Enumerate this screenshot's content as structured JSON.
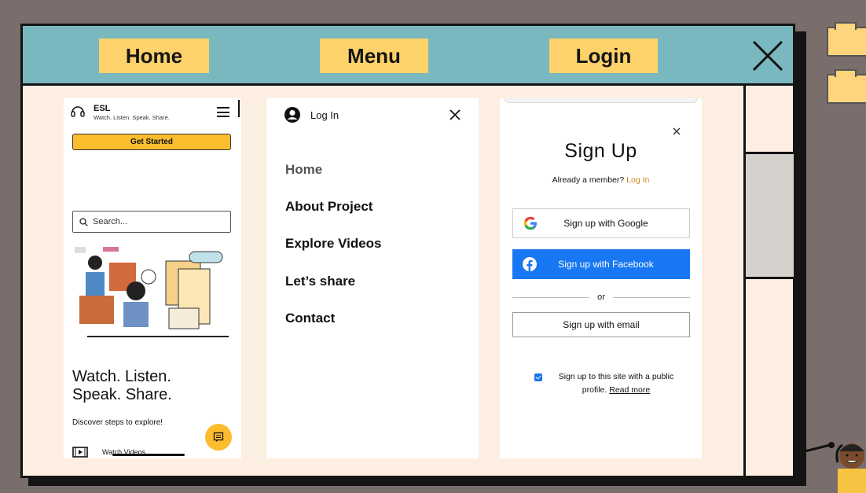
{
  "nav": {
    "tabs": [
      {
        "label": "Home"
      },
      {
        "label": "Menu"
      },
      {
        "label": "Login"
      }
    ],
    "close_icon": "close-icon"
  },
  "home_screen": {
    "brand": "ESL",
    "tagline": "Watch. Listen. Speak. Share.",
    "get_started": "Get Started",
    "search_placeholder": "Search...",
    "hero_title_line1": "Watch. Listen.",
    "hero_title_line2": "Speak. Share.",
    "discover": "Discover steps to explore!",
    "video_link": "Watch Videos",
    "accent": "#fbbd2e"
  },
  "menu_screen": {
    "login_label": "Log In",
    "items": [
      "Home",
      "About Project",
      "Explore Videos",
      "Let’s share",
      "Contact"
    ]
  },
  "login_screen": {
    "title": "Sign Up",
    "already_member": "Already a member?",
    "login_link": "Log In",
    "google": "Sign up with Google",
    "facebook": "Sign up with Facebook",
    "or": "or",
    "email": "Sign up with email",
    "public_profile": "Sign up to this site with a public profile.",
    "read_more": "Read more",
    "facebook_color": "#1877f2"
  }
}
